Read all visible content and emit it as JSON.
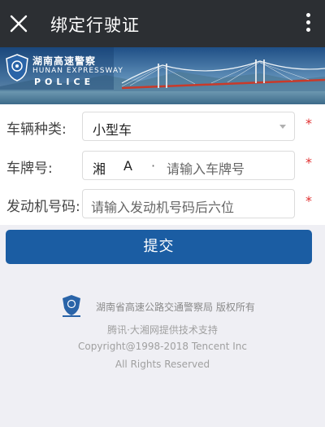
{
  "header": {
    "title": "绑定行驶证",
    "close_icon": "close-icon",
    "more_icon": "more-vertical-icon"
  },
  "banner": {
    "org_cn": "湖南高速警察",
    "org_en_1": "HUNAN EXPRESSWAY",
    "org_en_2": "POLICE",
    "badge_icon": "police-badge-icon"
  },
  "form": {
    "vehicle_type": {
      "label": "车辆种类:",
      "value": "小型车",
      "required_mark": "*"
    },
    "plate": {
      "label": "车牌号:",
      "province": "湘",
      "letter": "A",
      "separator": "·",
      "placeholder": "请输入车牌号",
      "required_mark": "*"
    },
    "engine": {
      "label": "发动机号码:",
      "placeholder": "请输入发动机号码后六位",
      "required_mark": "*"
    }
  },
  "submit_label": "提交",
  "footer": {
    "logo_icon": "police-badge-icon",
    "copyright_holder": "湖南省高速公路交通警察局 版权所有",
    "tech_support": "腾讯·大湘网提供技术支持",
    "copyright": "Copyright@1998-2018 Tencent Inc",
    "rights": "All Rights Reserved"
  },
  "colors": {
    "topbar": "#2c2f33",
    "primary": "#1b5da3",
    "required": "#e13232",
    "background": "#efeff4"
  }
}
